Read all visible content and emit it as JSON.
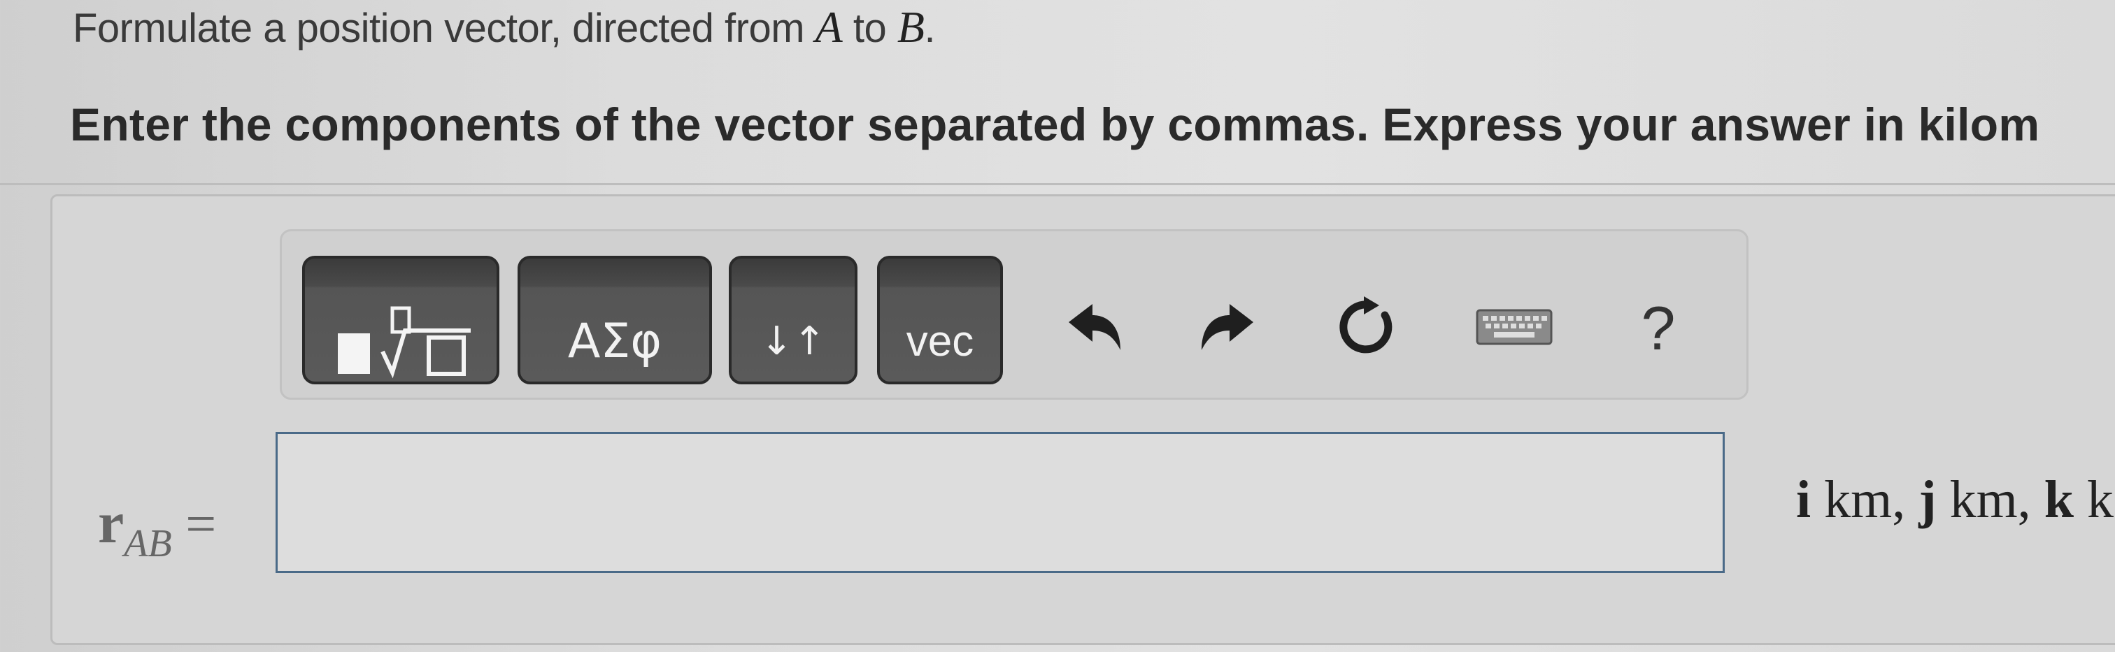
{
  "prompt": {
    "text_before": "Formulate a position vector, directed from ",
    "point_a": "A",
    "text_middle": " to ",
    "point_b": "B",
    "text_after": "."
  },
  "instruction": "Enter the components of the vector separated by commas. Express your answer in kilom",
  "toolbar": {
    "templates_icon": "fraction-root-template-icon",
    "greek_label": "ΑΣφ",
    "subscript_label": "↓↑",
    "vec_label": "vec",
    "undo_icon": "undo-icon",
    "redo_icon": "redo-icon",
    "reset_icon": "reset-icon",
    "keyboard_icon": "keyboard-icon",
    "help_label": "?"
  },
  "answer": {
    "lhs_symbol": "r",
    "lhs_subscript": "AB",
    "lhs_equals": " =",
    "value": "",
    "units_i": "i",
    "units_i_text": " km, ",
    "units_j": "j",
    "units_j_text": " km, ",
    "units_k": "k",
    "units_k_text": " k"
  },
  "colors": {
    "toolbar_button": "#4a4a4a",
    "input_border": "#4a6a88",
    "background": "#dcdcdc"
  }
}
